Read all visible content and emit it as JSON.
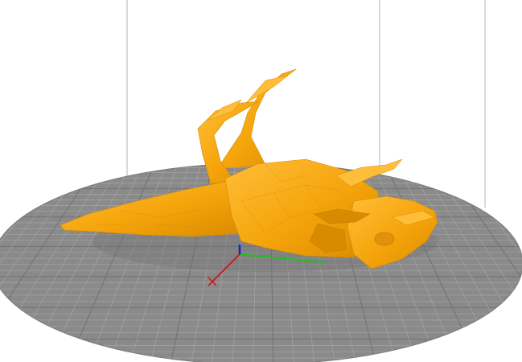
{
  "viewport": {
    "background": "#ffffff",
    "bed_color": "#8a8a8a",
    "bed_grid_color": "#a8a8a8",
    "bed_major_grid_color": "#6e6e6e",
    "build_volume_line_color": "#b4b4b4",
    "model_color": "#f5a40a",
    "model_shade_color": "#d98b00",
    "model_highlight_color": "#ffbe3a"
  },
  "axes": {
    "x_color": "#d01010",
    "y_color": "#20c020",
    "z_color": "#1020e0"
  },
  "model": {
    "icon": "dragon-mesh-icon"
  }
}
